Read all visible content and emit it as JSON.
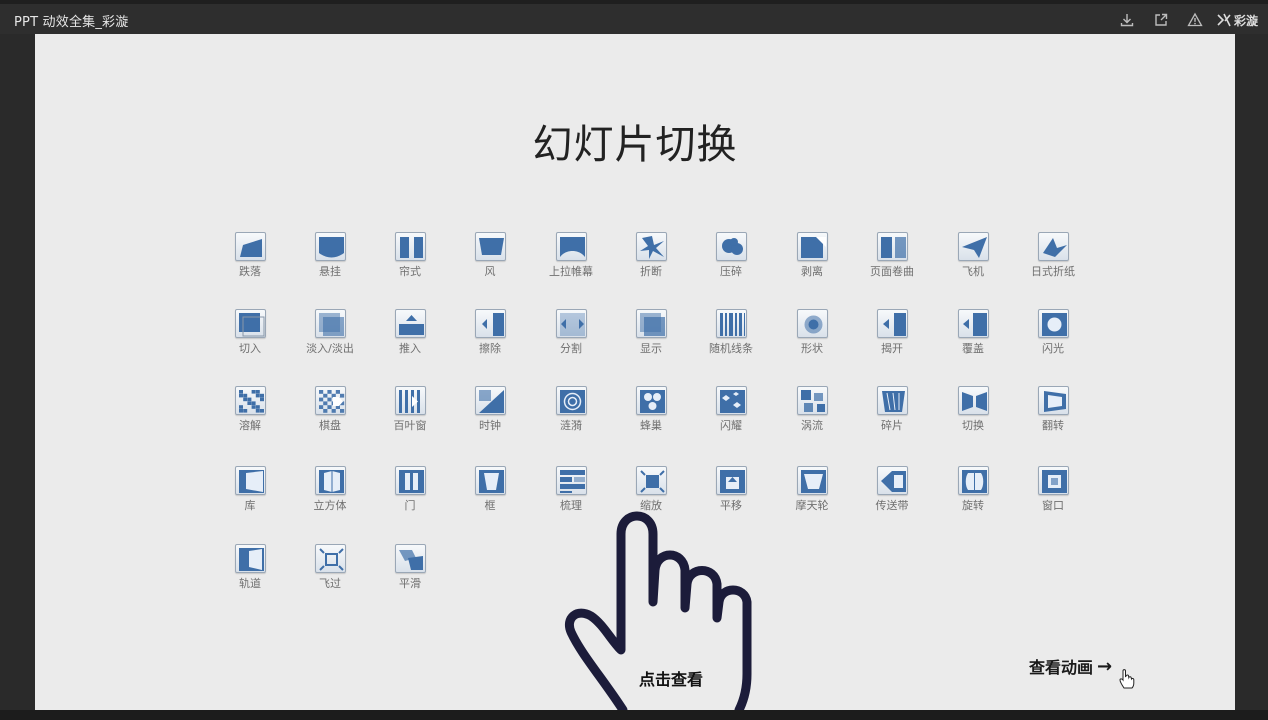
{
  "app": {
    "title": "PPT 动效全集_彩漩",
    "brand": "彩漩"
  },
  "slide": {
    "title": "幻灯片切换",
    "hand_label": "点击查看",
    "view_link": "查看动画",
    "view_arrow": "→"
  },
  "colors": {
    "accent": "#3f6fa8",
    "icon_border": "#9aa7b6",
    "label": "#6f6f6f"
  },
  "rows": [
    [
      {
        "label": "跌落",
        "icon": "fall-icon"
      },
      {
        "label": "悬挂",
        "icon": "drape-icon"
      },
      {
        "label": "帘式",
        "icon": "curtains-icon"
      },
      {
        "label": "风",
        "icon": "wind-icon"
      },
      {
        "label": "上拉帷幕",
        "icon": "prestige-icon"
      },
      {
        "label": "折断",
        "icon": "fracture-icon"
      },
      {
        "label": "压碎",
        "icon": "crush-icon"
      },
      {
        "label": "剥离",
        "icon": "peel-off-icon"
      },
      {
        "label": "页面卷曲",
        "icon": "page-curl-icon"
      },
      {
        "label": "飞机",
        "icon": "airplane-icon"
      },
      {
        "label": "日式折纸",
        "icon": "origami-icon"
      }
    ],
    [
      {
        "label": "切入",
        "icon": "cut-icon"
      },
      {
        "label": "淡入/淡出",
        "icon": "fade-icon"
      },
      {
        "label": "推入",
        "icon": "push-icon"
      },
      {
        "label": "擦除",
        "icon": "wipe-icon"
      },
      {
        "label": "分割",
        "icon": "split-icon"
      },
      {
        "label": "显示",
        "icon": "reveal-icon"
      },
      {
        "label": "随机线条",
        "icon": "random-bars-icon"
      },
      {
        "label": "形状",
        "icon": "shape-icon"
      },
      {
        "label": "揭开",
        "icon": "uncover-icon"
      },
      {
        "label": "覆盖",
        "icon": "cover-icon"
      },
      {
        "label": "闪光",
        "icon": "flash-icon"
      }
    ],
    [
      {
        "label": "溶解",
        "icon": "dissolve-icon"
      },
      {
        "label": "棋盘",
        "icon": "checkerboard-icon"
      },
      {
        "label": "百叶窗",
        "icon": "blinds-icon"
      },
      {
        "label": "时钟",
        "icon": "clock-icon"
      },
      {
        "label": "涟漪",
        "icon": "ripple-icon"
      },
      {
        "label": "蜂巢",
        "icon": "honeycomb-icon"
      },
      {
        "label": "闪耀",
        "icon": "glitter-icon"
      },
      {
        "label": "涡流",
        "icon": "vortex-icon"
      },
      {
        "label": "碎片",
        "icon": "shred-icon"
      },
      {
        "label": "切换",
        "icon": "switch-icon"
      },
      {
        "label": "翻转",
        "icon": "flip-icon"
      }
    ],
    [
      {
        "label": "库",
        "icon": "gallery-icon"
      },
      {
        "label": "立方体",
        "icon": "cube-icon"
      },
      {
        "label": "门",
        "icon": "doors-icon"
      },
      {
        "label": "框",
        "icon": "box-icon"
      },
      {
        "label": "梳理",
        "icon": "comb-icon"
      },
      {
        "label": "缩放",
        "icon": "zoom-icon"
      },
      {
        "label": "平移",
        "icon": "pan-icon"
      },
      {
        "label": "摩天轮",
        "icon": "ferris-wheel-icon"
      },
      {
        "label": "传送带",
        "icon": "conveyor-icon"
      },
      {
        "label": "旋转",
        "icon": "rotate-icon"
      },
      {
        "label": "窗口",
        "icon": "window-icon"
      }
    ],
    [
      {
        "label": "轨道",
        "icon": "orbit-icon"
      },
      {
        "label": "飞过",
        "icon": "fly-through-icon"
      },
      {
        "label": "平滑",
        "icon": "morph-icon"
      }
    ]
  ]
}
